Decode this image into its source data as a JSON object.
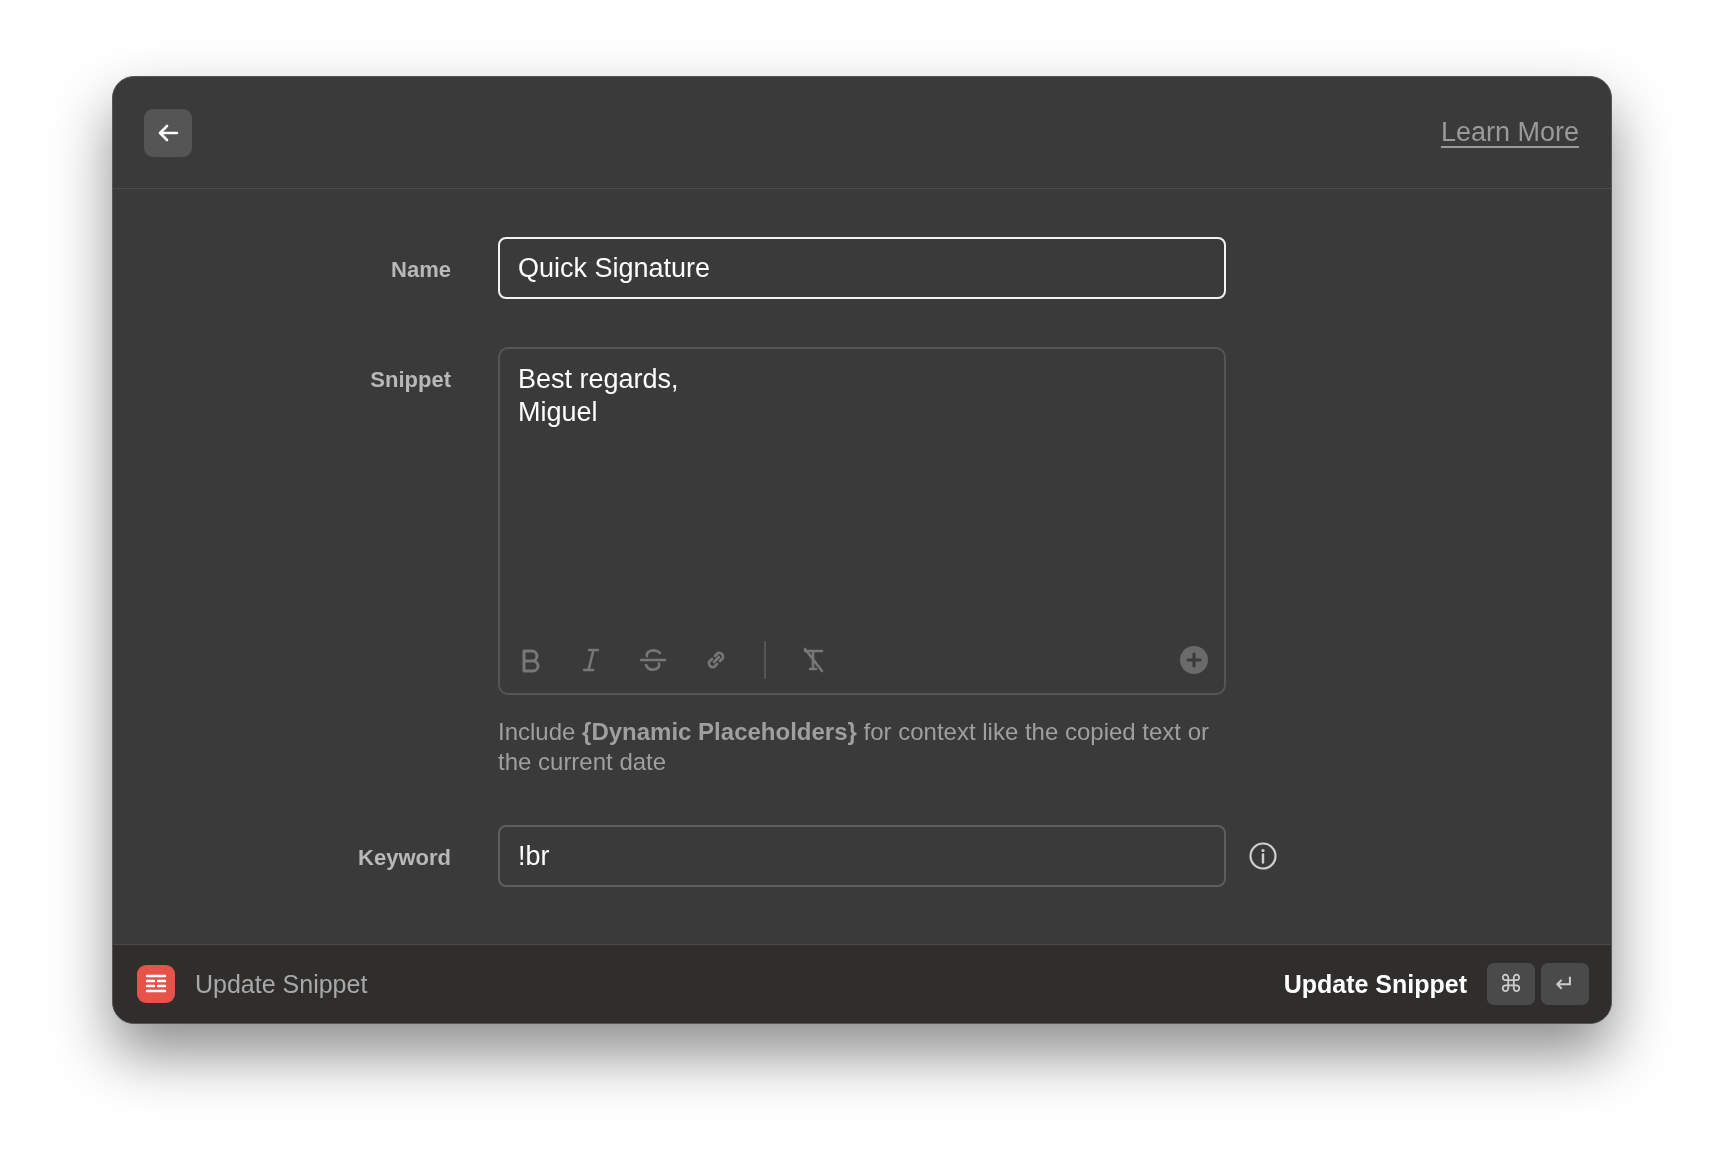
{
  "header": {
    "link": "Learn More"
  },
  "form": [
    {
      "kind": "input",
      "label": "Name",
      "value": "Quick Signature",
      "focused": true
    },
    {
      "kind": "editor",
      "label": "Snippet",
      "lines": [
        "Best regards,",
        "Miguel"
      ],
      "hint": "Include **{Dynamic Placeholders}** for context like the copied text or the current date"
    },
    {
      "kind": "input",
      "label": "Keyword",
      "value": "!br",
      "focused": false,
      "info": true
    }
  ],
  "footer": {
    "title": "Update Snippet",
    "action": "Update Snippet",
    "keys": [
      "⌘",
      "↵"
    ]
  }
}
